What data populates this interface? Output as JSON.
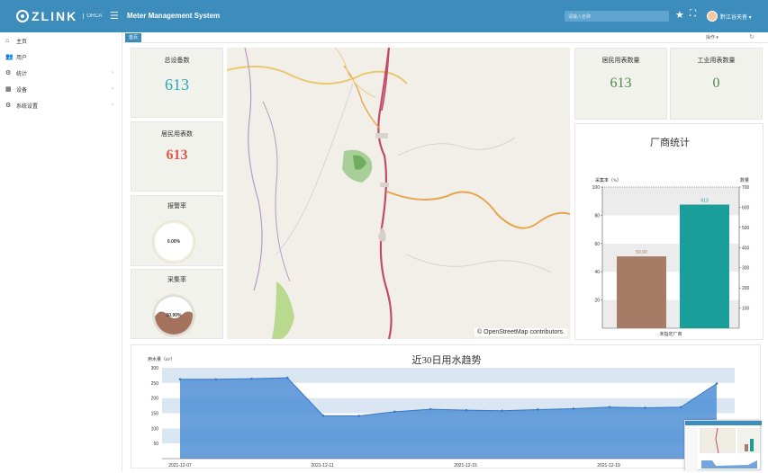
{
  "header": {
    "logo_text": "ZLINK",
    "logo_sub": "ORCA",
    "system_title": "Meter Management System",
    "search_placeholder": "请输入名称",
    "user_name": "黔江谷天杳 ▾"
  },
  "sidebar": {
    "items": [
      {
        "label": "主页",
        "icon": "home-icon"
      },
      {
        "label": "用户",
        "icon": "users-icon"
      },
      {
        "label": "统计",
        "icon": "gear-icon"
      },
      {
        "label": "设备",
        "icon": "device-icon"
      },
      {
        "label": "系统设置",
        "icon": "gear-icon"
      }
    ]
  },
  "tabs": {
    "home": "首页",
    "operations": "操作 ▾",
    "refresh": "↻"
  },
  "stats": {
    "total_devices_label": "总设备数",
    "total_devices_value": "613",
    "residential_users_label": "居民用表数",
    "residential_users_value": "613",
    "alarm_rate_label": "报警率",
    "alarm_rate_value": "0.00%",
    "collection_rate_label": "采集率",
    "collection_rate_value": "50.90%",
    "residential_meter_label": "居民用表数量",
    "residential_meter_value": "613",
    "industrial_meter_label": "工业用表数量",
    "industrial_meter_value": "0"
  },
  "map": {
    "attribution": "© OpenStreetMap contributors."
  },
  "colors": {
    "header_blue": "#3c8dbc",
    "teal_number": "#26a9b5",
    "red_number": "#e0564b",
    "green_number": "#4a8a4a",
    "bar_brown": "#a67c66",
    "bar_teal": "#1a9e9a",
    "area_blue": "#4f8fd6"
  },
  "chart_data": [
    {
      "type": "bar",
      "title": "厂商统计",
      "ylabel": "采集率（%）",
      "y2label": "数量",
      "categories": [
        "未指定厂商"
      ],
      "series": [
        {
          "name": "采集率",
          "values": [
            50.9
          ],
          "labels": [
            "50.90"
          ],
          "axis": "left"
        },
        {
          "name": "数量",
          "values": [
            613
          ],
          "labels": [
            "613"
          ],
          "axis": "right"
        }
      ],
      "ylim": [
        0,
        100
      ],
      "y2lim": [
        0,
        700
      ],
      "yticks": [
        "100",
        "80",
        "60",
        "40",
        "20"
      ],
      "y2ticks": [
        "700",
        "600",
        "500",
        "400",
        "300",
        "200",
        "100"
      ]
    },
    {
      "type": "area",
      "title": "近30日用水趋势",
      "ylabel": "用水量（m³）",
      "ylim": [
        0,
        300
      ],
      "yticks": [
        "300",
        "250",
        "200",
        "150",
        "100",
        "50"
      ],
      "x_tick_labels": [
        "2021-12-07",
        "2021-12-11",
        "2021-12-15",
        "2021-12-19"
      ],
      "values": [
        262,
        262,
        264,
        267,
        142,
        141,
        155,
        163,
        160,
        158,
        162,
        165,
        170,
        168,
        170,
        248
      ]
    }
  ]
}
